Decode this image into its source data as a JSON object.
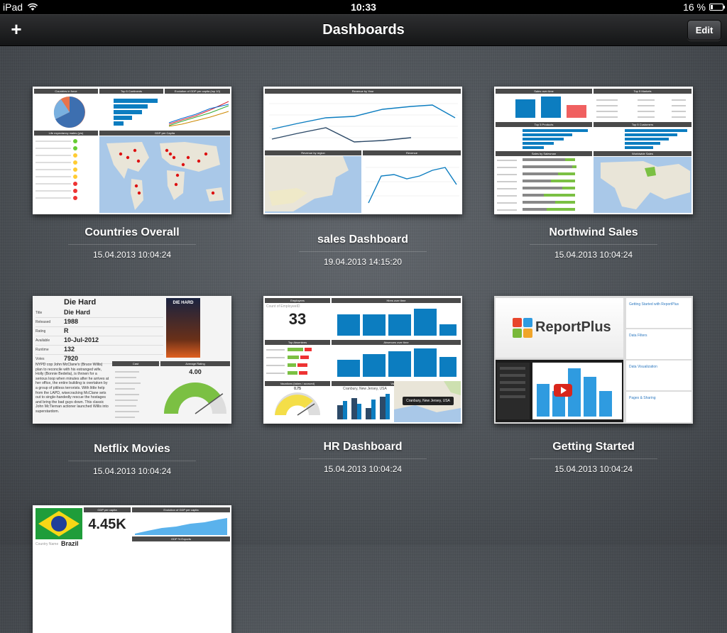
{
  "status_bar": {
    "carrier": "iPad",
    "time": "10:33",
    "battery_text": "16 %",
    "battery_level": 0.16,
    "wifi_icon": "wifi-icon",
    "battery_icon": "battery-icon"
  },
  "nav": {
    "title": "Dashboards",
    "add_label": "+",
    "edit_label": "Edit"
  },
  "dashboards": [
    {
      "title": "Countries Overall",
      "date": "15.04.2013 10:04:24",
      "thumb_headers": [
        "Countries in force",
        "Top 5 Continents",
        "Evolution of GDP per capita (top 10)",
        "Life expectancy males (yrs)",
        "GDP per Capita"
      ]
    },
    {
      "title": "sales Dashboard",
      "date": "19.04.2013 14:15:20",
      "thumb_headers": [
        "Revenue by Year",
        "Revenue by region",
        "Revenue"
      ]
    },
    {
      "title": "Northwind Sales",
      "date": "15.04.2013 10:04:24",
      "thumb_headers": [
        "Sales over time",
        "Top 5 Markets",
        "Top 5 Products",
        "Top 5 Customers",
        "Sales by Salesman",
        "Worldwide Sales"
      ]
    },
    {
      "title": "Netflix Movies",
      "date": "15.04.2013 10:04:24",
      "thumb": {
        "movie_title": "Die Hard",
        "fields": [
          {
            "label": "Title",
            "value": "Die Hard"
          },
          {
            "label": "Released",
            "value": "1988"
          },
          {
            "label": "Rating",
            "value": "R"
          },
          {
            "label": "Available",
            "value": "10-Jul-2012"
          },
          {
            "label": "Runtime",
            "value": "132"
          },
          {
            "label": "Votes",
            "value": "7920"
          }
        ],
        "poster_text": "DIE HARD",
        "synopsis": "NYPD cop John McClane's (Bruce Willis) plan to reconcile with his estranged wife, Holly (Bonnie Bedelia), is thrown for a serious loop when minutes after he arrives at her office, the entire building is overtaken by a group of pitiless terrorists. With little help from the LAPD, wisecracking McClane sets out to single-handedly rescue the hostages and bring the bad guys down. This classic John McTiernan actioner launched Willis into superstardom.",
        "cast_header": "Cast",
        "rating_header": "Average Rating",
        "rating_value": "4.00",
        "rating_fraction": 0.8
      }
    },
    {
      "title": "HR Dashboard",
      "date": "15.04.2013 10:04:24",
      "thumb": {
        "employees_header": "Employees",
        "count_label": "Count of EmployeeID",
        "count_value": "33",
        "hires_header": "Hires over time",
        "absentees_header": "Top Absentees",
        "absences_header": "Absences over time",
        "vacations_header": "Vacations (taken / accrued)",
        "vacations_value": "0.75",
        "vacation_header": "Vacation",
        "legend": "Cranbury, New Jersey, USA",
        "map_callout": "Cranbury, New Jersey, USA"
      }
    },
    {
      "title": "Getting Started",
      "date": "15.04.2013 10:04:24",
      "thumb": {
        "logo_text": "ReportPlus",
        "doc_titles": [
          "Getting Started with ReportPlus",
          "Data Filters",
          "Data Visualization",
          "Pages & Sharing"
        ]
      }
    },
    {
      "title": "",
      "date": "",
      "thumb": {
        "kpi_header": "GDP per capita",
        "kpi_value": "4.45K",
        "evolution_header": "Evolution of GDP per capita",
        "exports_header": "GDP % Exports",
        "country_label": "Country Name",
        "country_value": "Brazil"
      }
    }
  ]
}
